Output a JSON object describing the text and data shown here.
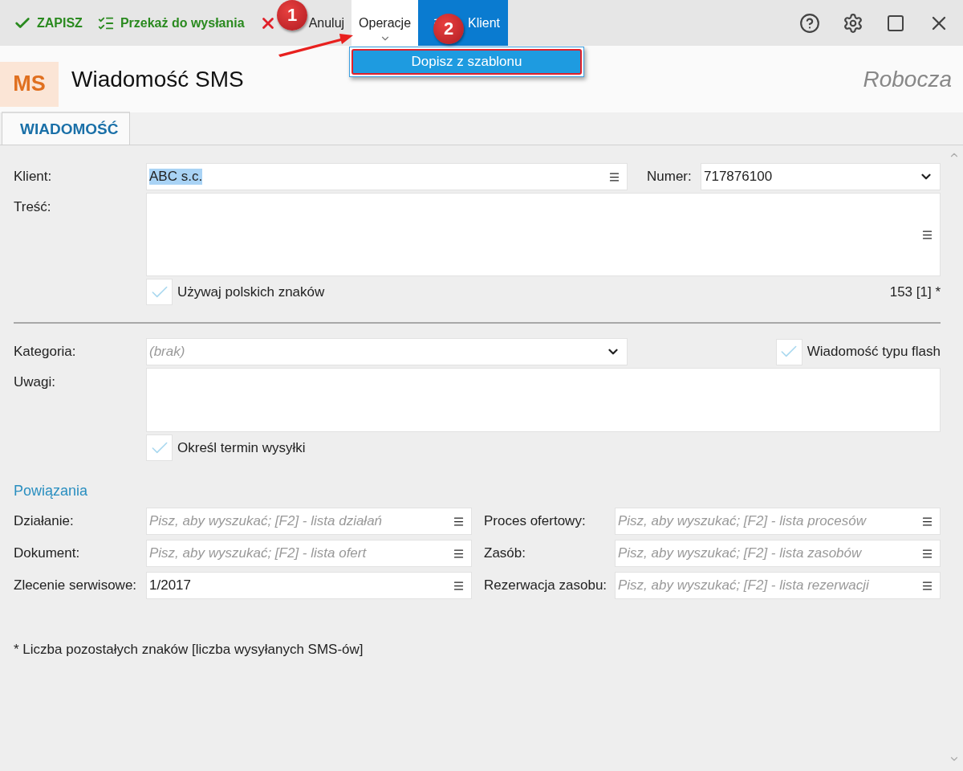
{
  "toolbar": {
    "buttons": [
      {
        "label": "ZAPISZ",
        "kind": "save",
        "expanded": false
      },
      {
        "label": "Przekaż do wysłania",
        "kind": "send",
        "expanded": false
      },
      {
        "label": "Anuluj",
        "kind": "cancel",
        "expanded": false
      },
      {
        "label": "Operacje",
        "kind": "dropdown",
        "expanded": true
      },
      {
        "label": "Klient",
        "kind": "client",
        "expanded": false
      }
    ]
  },
  "dropdown_menu": {
    "items": [
      {
        "label": "Dopisz z szablonu",
        "selected": true
      }
    ]
  },
  "annotations": [
    {
      "label": "1"
    },
    {
      "label": "2"
    }
  ],
  "header": {
    "badge": "MS",
    "title": "Wiadomość SMS",
    "status": "Robocza"
  },
  "tabs": [
    {
      "label": "WIADOMOŚĆ",
      "selected": true
    }
  ],
  "form": {
    "client": {
      "label": "Klient:",
      "value": "ABC s.c.",
      "highlighted": true
    },
    "number": {
      "label": "Numer:",
      "value": "717876100"
    },
    "content": {
      "label": "Treść:"
    },
    "counter": "153 [1] *",
    "polish_chars": {
      "label": "Używaj polskich znaków",
      "checked": true
    },
    "category": {
      "label": "Kategoria:",
      "placeholder": "(brak)"
    },
    "flash": {
      "label": "Wiadomość typu flash",
      "checked": true
    },
    "notes": {
      "label": "Uwagi:"
    },
    "schedule": {
      "label": "Określ termin wysyłki",
      "checked": true
    }
  },
  "links": {
    "title": "Powiązania",
    "fields": [
      {
        "label": "Działanie:",
        "placeholder": "Pisz, aby wyszukać; [F2] - lista działań"
      },
      {
        "label": "Proces ofertowy:",
        "placeholder": "Pisz, aby wyszukać; [F2] - lista procesów"
      },
      {
        "label": "Dokument:",
        "placeholder": "Pisz, aby wyszukać; [F2] - lista ofert"
      },
      {
        "label": "Zasób:",
        "placeholder": "Pisz, aby wyszukać; [F2] - lista zasobów"
      },
      {
        "label": "Zlecenie serwisowe:",
        "value": "1/2017"
      },
      {
        "label": "Rezerwacja zasobu:",
        "placeholder": "Pisz, aby wyszukać; [F2] - lista rezerwacji"
      }
    ]
  },
  "footnote": "* Liczba pozostałych znaków [liczba wysyłanych SMS-ów]"
}
